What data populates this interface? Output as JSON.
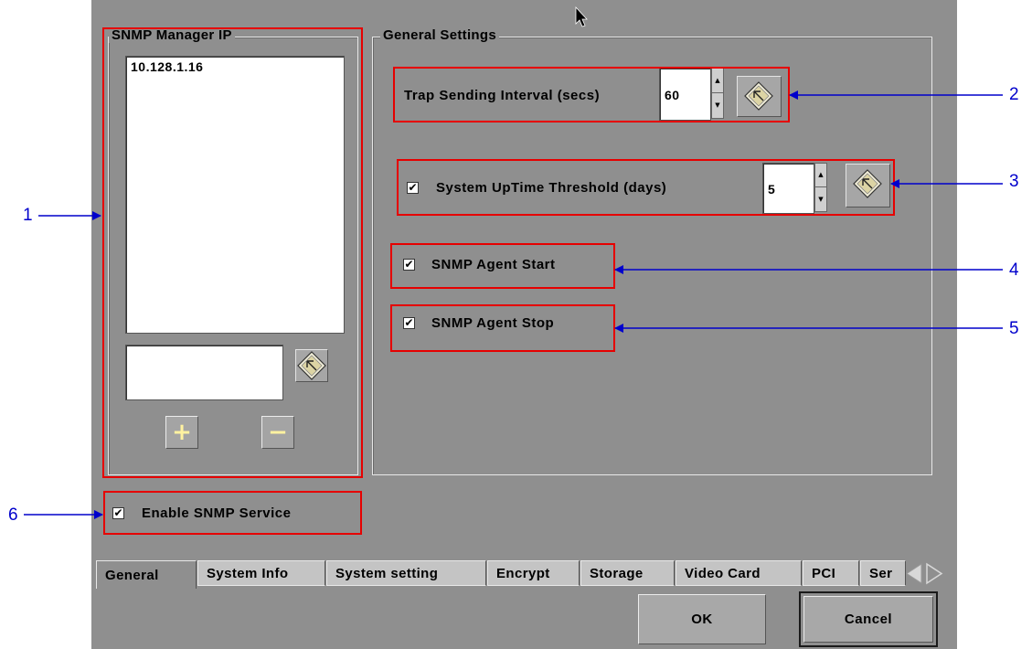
{
  "snmp_manager": {
    "legend": "SNMP Manager IP",
    "ip_list": [
      "10.128.1.16"
    ],
    "new_ip_value": "",
    "add_symbol": "+",
    "remove_symbol": "−",
    "keyboard_icon": "keyboard-icon"
  },
  "general_settings": {
    "legend": "General Settings",
    "trap_interval": {
      "label": "Trap Sending Interval (secs)",
      "value": "60"
    },
    "uptime_threshold": {
      "label": "System UpTime Threshold (days)",
      "value": "5",
      "checked": true
    },
    "agent_start": {
      "label": "SNMP Agent Start",
      "checked": true
    },
    "agent_stop": {
      "label": "SNMP Agent Stop",
      "checked": true
    }
  },
  "enable_service": {
    "label": "Enable SNMP Service",
    "checked": true
  },
  "checkmark": "✔",
  "tabs": [
    {
      "label": "General",
      "active": true
    },
    {
      "label": "System Info"
    },
    {
      "label": "System setting"
    },
    {
      "label": "Encrypt"
    },
    {
      "label": "Storage"
    },
    {
      "label": "Video Card"
    },
    {
      "label": "PCI"
    },
    {
      "label": "Ser"
    }
  ],
  "buttons": {
    "ok": "OK",
    "cancel": "Cancel"
  },
  "annotations": [
    "1",
    "2",
    "3",
    "4",
    "5",
    "6"
  ],
  "colors": {
    "panel": "#8f8f8f",
    "highlight": "#e60000",
    "annotation": "#0000cc",
    "tab": "#c4c4c4"
  }
}
